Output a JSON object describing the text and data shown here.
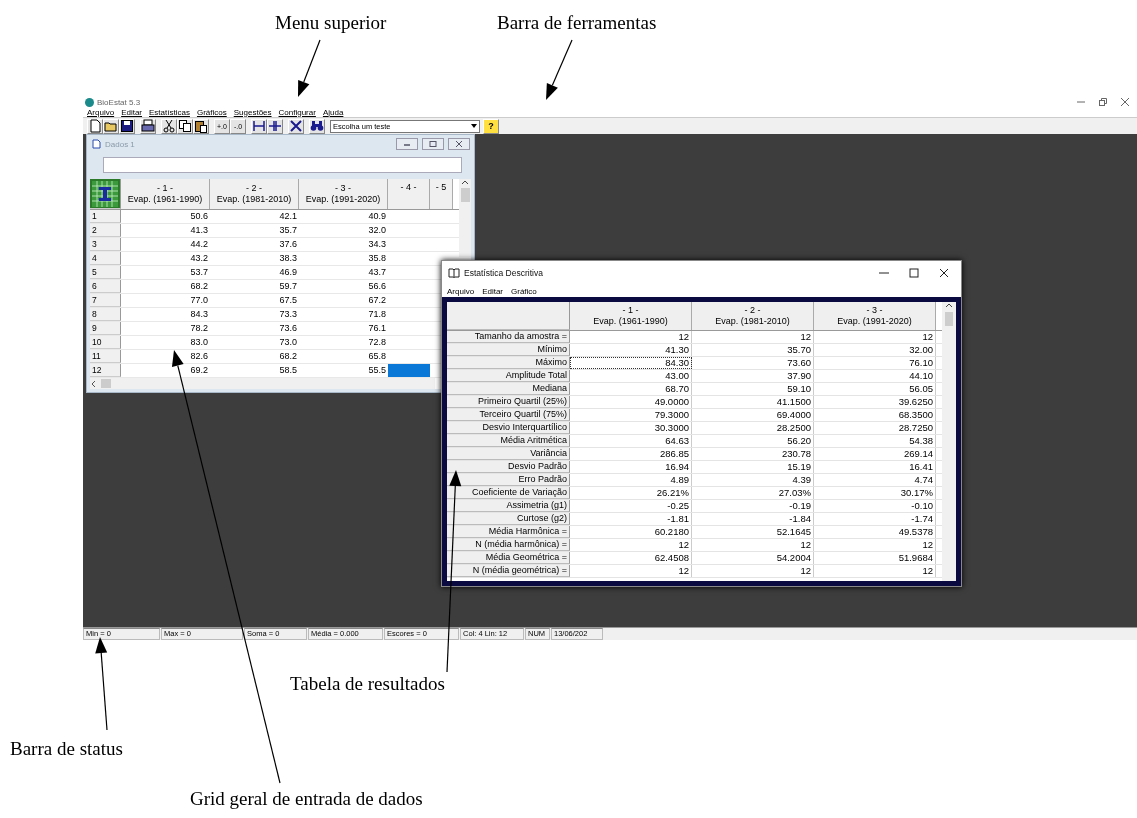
{
  "annotations": [
    {
      "text": "Menu superior"
    },
    {
      "text": "Barra de ferramentas"
    },
    {
      "text": "Tabela de resultados"
    },
    {
      "text": "Barra de status"
    },
    {
      "text": "Grid geral de entrada de dados"
    }
  ],
  "app": {
    "title": "BioEstat 5.3",
    "menu": [
      "Arquivo",
      "Editar",
      "Estatísticas",
      "Gráficos",
      "Sugestões",
      "Configurar",
      "Ajuda"
    ],
    "toolbar": {
      "decimal_buttons": [
        "+.0",
        "-.0"
      ],
      "test_select": "Escolha um teste",
      "help": "?"
    }
  },
  "data_window": {
    "title": "Dados 1",
    "columns": [
      {
        "number": "- 1 -",
        "label": "Evap. (1961-1990)"
      },
      {
        "number": "- 2 -",
        "label": "Evap. (1981-2010)"
      },
      {
        "number": "- 3 -",
        "label": "Evap. (1991-2020)"
      },
      {
        "number": "- 4 -"
      },
      {
        "number": "- 5"
      }
    ],
    "rows": [
      {
        "label": "1",
        "values": [
          "50.6",
          "42.1",
          "40.9"
        ],
        "selected": false
      },
      {
        "label": "2",
        "values": [
          "41.3",
          "35.7",
          "32.0"
        ],
        "selected": false
      },
      {
        "label": "3",
        "values": [
          "44.2",
          "37.6",
          "34.3"
        ],
        "selected": false
      },
      {
        "label": "4",
        "values": [
          "43.2",
          "38.3",
          "35.8"
        ],
        "selected": false
      },
      {
        "label": "5",
        "values": [
          "53.7",
          "46.9",
          "43.7"
        ],
        "selected": false
      },
      {
        "label": "6",
        "values": [
          "68.2",
          "59.7",
          "56.6"
        ],
        "selected": false
      },
      {
        "label": "7",
        "values": [
          "77.0",
          "67.5",
          "67.2"
        ],
        "selected": false
      },
      {
        "label": "8",
        "values": [
          "84.3",
          "73.3",
          "71.8"
        ],
        "selected": false
      },
      {
        "label": "9",
        "values": [
          "78.2",
          "73.6",
          "76.1"
        ],
        "selected": false
      },
      {
        "label": "10",
        "values": [
          "83.0",
          "73.0",
          "72.8"
        ],
        "selected": false
      },
      {
        "label": "11",
        "values": [
          "82.6",
          "68.2",
          "65.8"
        ],
        "selected": false
      },
      {
        "label": "12",
        "values": [
          "69.2",
          "58.5",
          "55.5"
        ],
        "selected": true
      }
    ]
  },
  "results_window": {
    "title": "Estatística Descritiva",
    "menu": [
      "Arquivo",
      "Editar",
      "Gráfico"
    ],
    "columns": [
      {
        "number": "- 1 -",
        "label": "Evap. (1961-1990)"
      },
      {
        "number": "- 2 -",
        "label": "Evap. (1981-2010)"
      },
      {
        "number": "- 3 -",
        "label": "Evap. (1991-2020)"
      }
    ],
    "rows": [
      {
        "label": "Tamanho da amostra =",
        "values": [
          "12",
          "12",
          "12"
        ],
        "focused": false
      },
      {
        "label": "Mínimo",
        "values": [
          "41.30",
          "35.70",
          "32.00"
        ],
        "focused": false
      },
      {
        "label": "Máximo",
        "values": [
          "84.30",
          "73.60",
          "76.10"
        ],
        "focused": true
      },
      {
        "label": "Amplitude Total",
        "values": [
          "43.00",
          "37.90",
          "44.10"
        ],
        "focused": false
      },
      {
        "label": "Mediana",
        "values": [
          "68.70",
          "59.10",
          "56.05"
        ],
        "focused": false
      },
      {
        "label": "Primeiro Quartil (25%)",
        "values": [
          "49.0000",
          "41.1500",
          "39.6250"
        ],
        "focused": false
      },
      {
        "label": "Terceiro Quartil (75%)",
        "values": [
          "79.3000",
          "69.4000",
          "68.3500"
        ],
        "focused": false
      },
      {
        "label": "Desvio Interquartílico",
        "values": [
          "30.3000",
          "28.2500",
          "28.7250"
        ],
        "focused": false
      },
      {
        "label": "Média Aritmética",
        "values": [
          "64.63",
          "56.20",
          "54.38"
        ],
        "focused": false
      },
      {
        "label": "Variância",
        "values": [
          "286.85",
          "230.78",
          "269.14"
        ],
        "focused": false
      },
      {
        "label": "Desvio Padrão",
        "values": [
          "16.94",
          "15.19",
          "16.41"
        ],
        "focused": false
      },
      {
        "label": "Erro Padrão",
        "values": [
          "4.89",
          "4.39",
          "4.74"
        ],
        "focused": false
      },
      {
        "label": "Coeficiente de Variação",
        "values": [
          "26.21%",
          "27.03%",
          "30.17%"
        ],
        "focused": false
      },
      {
        "label": "Assimetria (g1)",
        "values": [
          "-0.25",
          "-0.19",
          "-0.10"
        ],
        "focused": false
      },
      {
        "label": "Curtose (g2)",
        "values": [
          "-1.81",
          "-1.84",
          "-1.74"
        ],
        "focused": false
      },
      {
        "label": "Média Harmônica =",
        "values": [
          "60.2180",
          "52.1645",
          "49.5378"
        ],
        "focused": false
      },
      {
        "label": "N (média harmônica) =",
        "values": [
          "12",
          "12",
          "12"
        ],
        "focused": false
      },
      {
        "label": "Média Geométrica =",
        "values": [
          "62.4508",
          "54.2004",
          "51.9684"
        ],
        "focused": false
      },
      {
        "label": "N (média geométrica) =",
        "values": [
          "12",
          "12",
          "12"
        ],
        "focused": false
      }
    ]
  },
  "status_bar": [
    "Min = 0",
    "Max = 0",
    "Soma = 0",
    "Média = 0.000",
    "Escores = 0",
    "Col: 4  Lin: 12",
    "NUM",
    "13/06/202"
  ]
}
